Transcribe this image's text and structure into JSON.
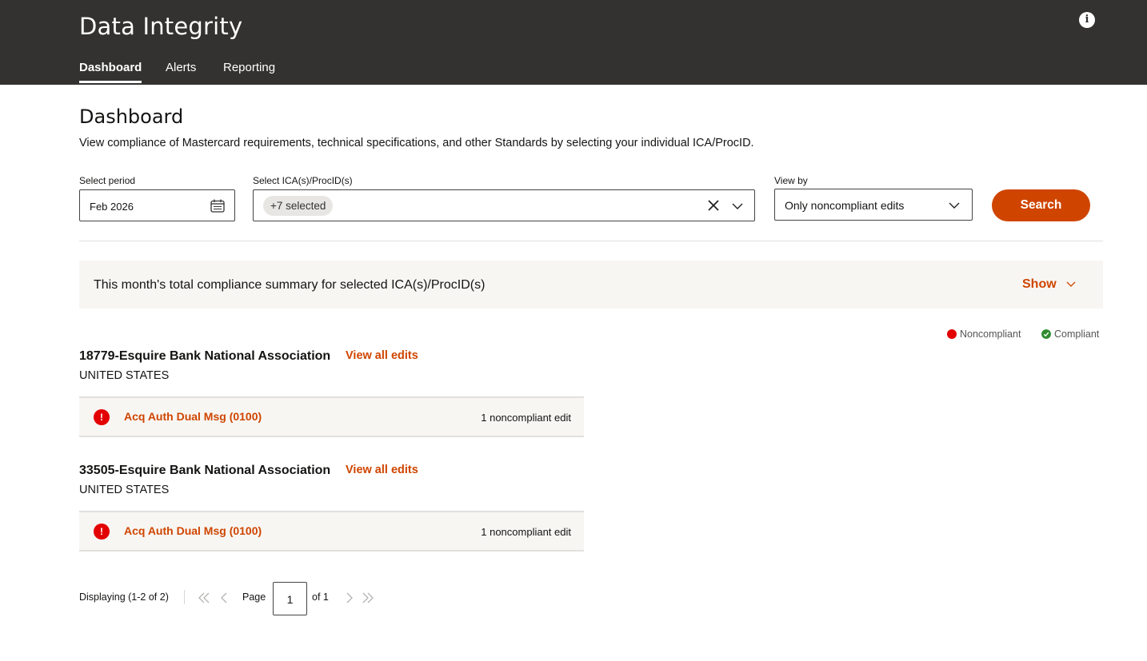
{
  "app": {
    "title": "Data Integrity"
  },
  "nav": {
    "tabs": [
      "Dashboard",
      "Alerts",
      "Reporting"
    ],
    "active": "Dashboard"
  },
  "page": {
    "title": "Dashboard",
    "description": "View compliance of Mastercard requirements, technical specifications, and other Standards by selecting your individual ICA/ProcID."
  },
  "filters": {
    "period_label": "Select period",
    "period_value": "Feb 2026",
    "ica_label": "Select ICA(s)/ProcID(s)",
    "ica_chip": "+7 selected",
    "viewby_label": "View by",
    "viewby_value": "Only noncompliant edits",
    "search_label": "Search"
  },
  "summary": {
    "text": "This month's total compliance summary for selected ICA(s)/ProcID(s)",
    "toggle_label": "Show"
  },
  "legend": {
    "noncompliant": "Noncompliant",
    "compliant": "Compliant"
  },
  "sections": [
    {
      "title": "18779-Esquire Bank National Association",
      "link": "View all edits",
      "country": "UNITED STATES",
      "edits": [
        {
          "name": "Acq Auth Dual Msg (0100)",
          "count": "1 noncompliant edit"
        }
      ]
    },
    {
      "title": "33505-Esquire Bank National Association",
      "link": "View all edits",
      "country": "UNITED STATES",
      "edits": [
        {
          "name": "Acq Auth Dual Msg (0100)",
          "count": "1 noncompliant edit"
        }
      ]
    }
  ],
  "pagination": {
    "display": "Displaying (1-2 of 2)",
    "page_label": "Page",
    "current_page": "1",
    "of_label": "of 1"
  },
  "colors": {
    "header_bg": "#333231",
    "accent": "#cf4500",
    "noncompliant": "#e30000",
    "compliant": "#2e8b2e",
    "panel_bg": "#f8f6f3"
  },
  "icons": {
    "info": "info-icon",
    "calendar": "calendar-icon",
    "clear": "close-icon",
    "dropdown": "chevron-down-icon",
    "alert": "exclamation-circle-icon",
    "compliant": "check-circle-icon"
  }
}
